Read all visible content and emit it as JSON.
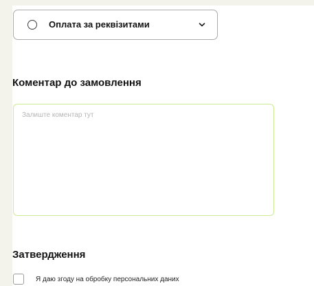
{
  "payment": {
    "selected_option": "Оплата за реквізитами",
    "radio_icon": "radio-unchecked-icon",
    "dropdown_icon": "chevron-down-icon"
  },
  "comment": {
    "title": "Коментар до замовлення",
    "placeholder": "Залиште коментар тут",
    "value": ""
  },
  "confirmation": {
    "title": "Затвердження",
    "consent_label": "Я даю згоду на обробку персональних даних",
    "consent_checked": false
  },
  "colors": {
    "page_background": "#f3f3ec",
    "panel_background": "#ffffff",
    "comment_border": "#cdea95",
    "select_border": "#a9a9a9",
    "text": "#111111"
  }
}
